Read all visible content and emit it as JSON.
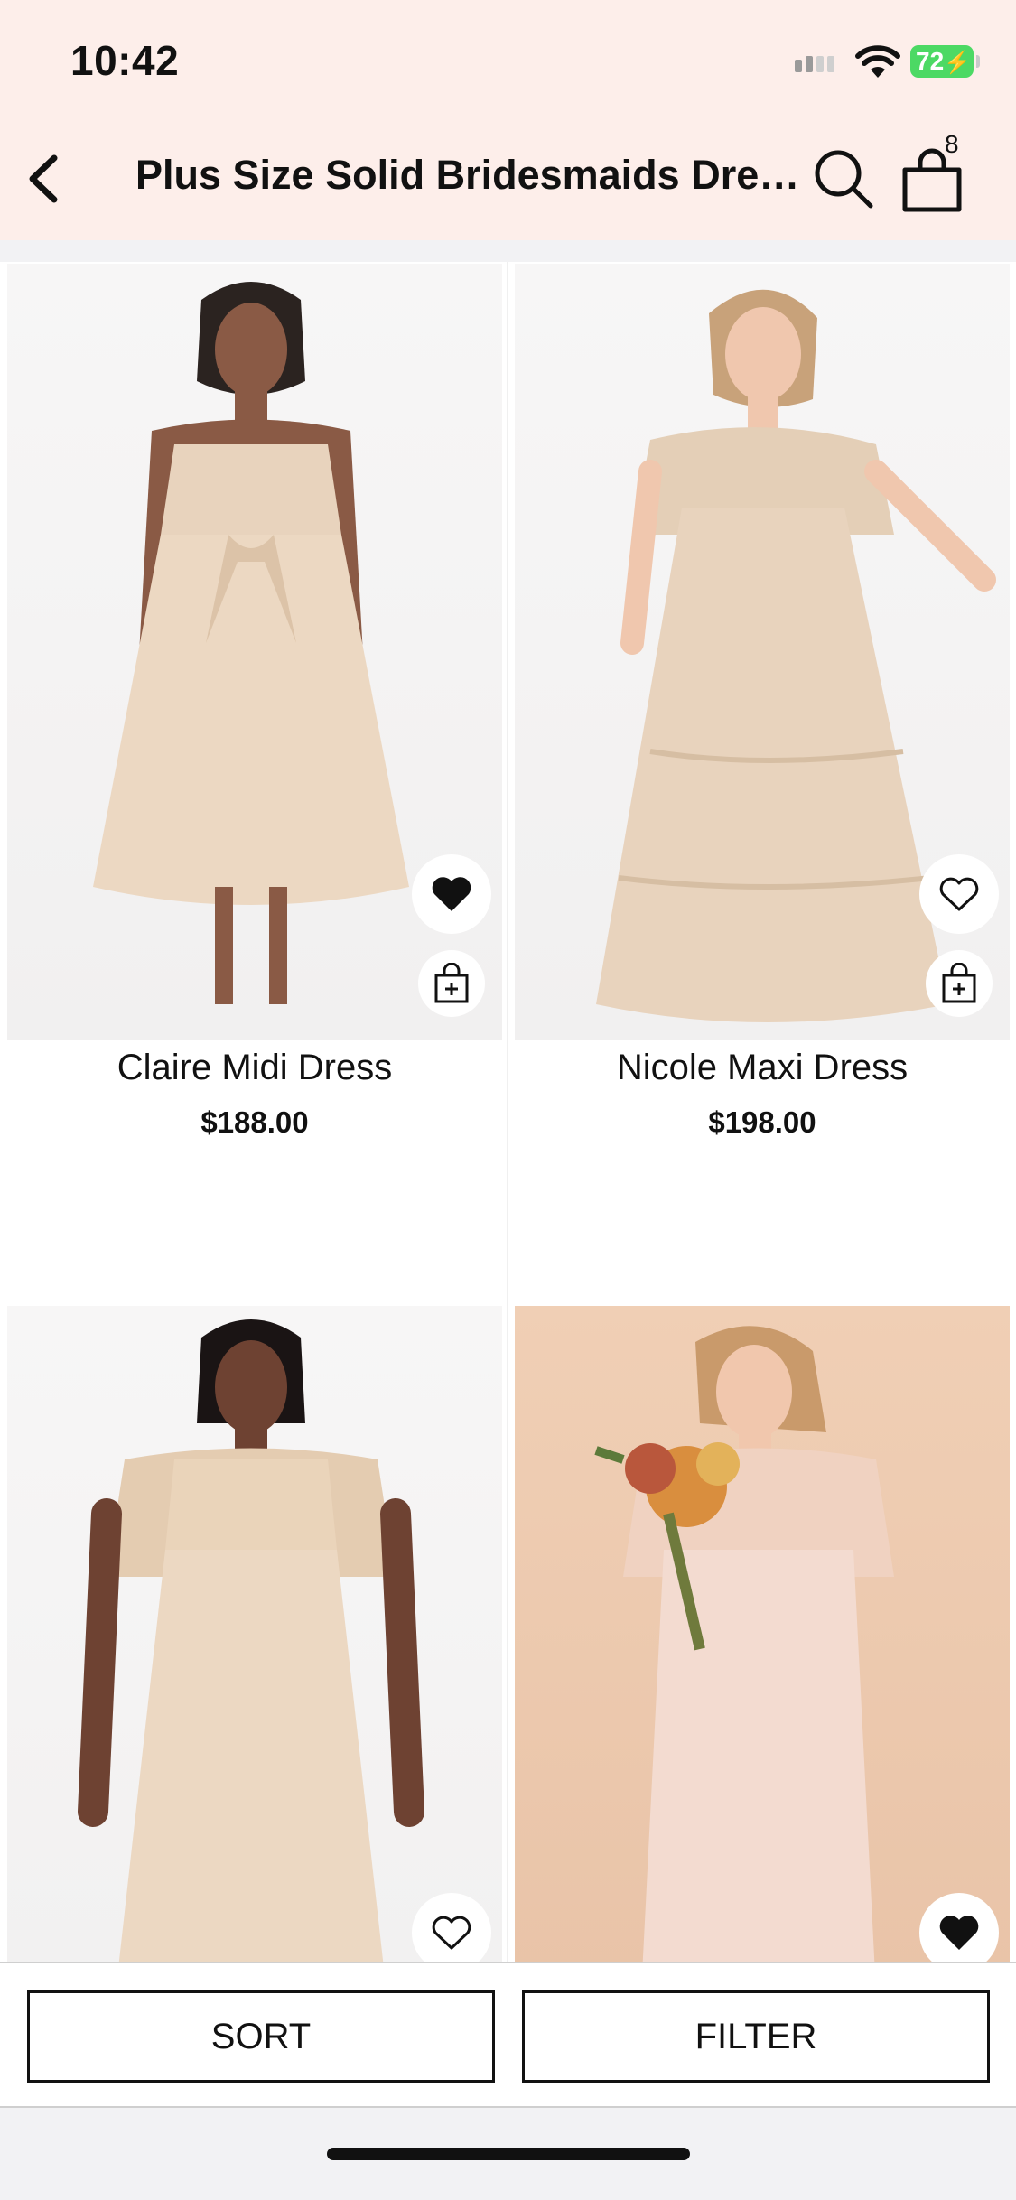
{
  "status_bar": {
    "time": "10:42",
    "battery": "72"
  },
  "header": {
    "title": "Plus Size Solid Bridesmaids Dres...",
    "cart_count": "8"
  },
  "products": [
    {
      "name": "Claire Midi Dress",
      "price": "$188.00",
      "wishlisted": true
    },
    {
      "name": "Nicole Maxi Dress",
      "price": "$198.00",
      "wishlisted": false
    },
    {
      "name": "",
      "price": "",
      "wishlisted": false
    },
    {
      "name": "",
      "price": "",
      "wishlisted": true
    }
  ],
  "bottom_bar": {
    "sort_label": "SORT",
    "filter_label": "FILTER"
  },
  "colors": {
    "header_bg": "#fdeeea",
    "dress_champagne": "#e8d3bd",
    "battery_green": "#4cd964"
  },
  "icons": [
    "back-chevron-icon",
    "search-icon",
    "shopping-bag-icon",
    "heart-icon",
    "add-to-bag-icon"
  ]
}
